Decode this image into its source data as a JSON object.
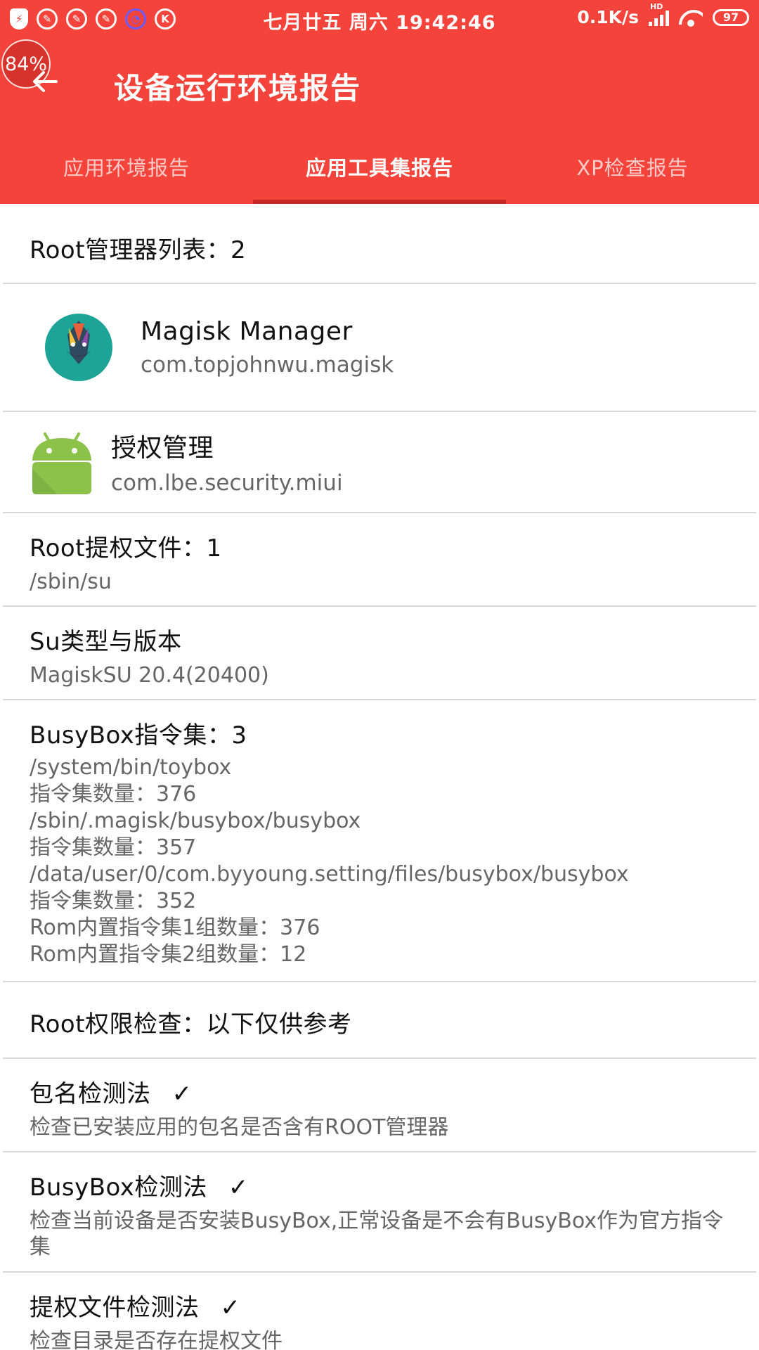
{
  "status_bar": {
    "clock": "七月廿五 周六 19:42:46",
    "net_speed": "0.1K/s",
    "net_type": "HD",
    "battery": "97",
    "left_icon_letters": [
      "K"
    ]
  },
  "overlay": {
    "percent": "84%"
  },
  "header": {
    "title": "设备运行环境报告",
    "tabs": [
      "应用环境报告",
      "应用工具集报告",
      "XP检查报告"
    ],
    "active_tab": 1
  },
  "sections": {
    "root_managers": {
      "title": "Root管理器列表：2"
    },
    "apps": [
      {
        "name": "Magisk Manager",
        "package": "com.topjohnwu.magisk",
        "icon": "magisk-icon"
      },
      {
        "name": "授权管理",
        "package": "com.lbe.security.miui",
        "icon": "android-icon"
      }
    ],
    "root_files": {
      "title": "Root提权文件：1",
      "detail": "/sbin/su"
    },
    "su_type": {
      "title": "Su类型与版本",
      "detail": "MagiskSU 20.4(20400)"
    },
    "busybox": {
      "title": "BusyBox指令集：3",
      "lines": [
        "/system/bin/toybox",
        "指令集数量：376",
        "/sbin/.magisk/busybox/busybox",
        "指令集数量：357",
        "/data/user/0/com.byyoung.setting/files/busybox/busybox",
        "指令集数量：352",
        "Rom内置指令集1组数量：376",
        "Rom内置指令集2组数量：12"
      ]
    },
    "root_check": {
      "title": "Root权限检查：以下仅供参考"
    },
    "checks": [
      {
        "title": "包名检测法",
        "mark": "✓",
        "detail": "检查已安装应用的包名是否含有ROOT管理器"
      },
      {
        "title": "BusyBox检测法",
        "mark": "✓",
        "detail": "检查当前设备是否安装BusyBox,正常设备是不会有BusyBox作为官方指令集"
      },
      {
        "title": "提权文件检测法",
        "mark": "✓",
        "detail": "检查目录是否存在提权文件"
      }
    ]
  },
  "colors": {
    "accent": "#f4433a",
    "indicator": "#c62828",
    "divider": "#d9d9d9"
  }
}
